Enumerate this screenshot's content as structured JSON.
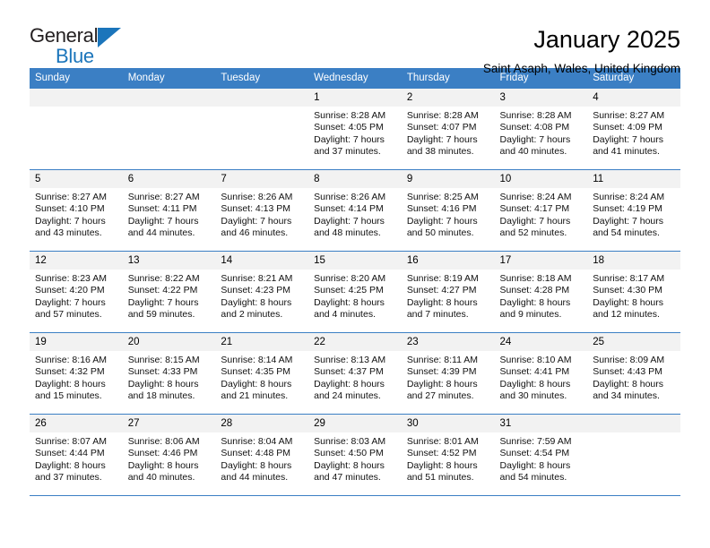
{
  "brand": {
    "name_top": "General",
    "name_bottom": "Blue",
    "accent_color": "#1b75bb"
  },
  "header": {
    "title": "January 2025",
    "subtitle": "Saint Asaph, Wales, United Kingdom"
  },
  "theme": {
    "header_row_bg": "#3b7fc4",
    "daynum_bg": "#f2f2f2",
    "grid_line": "#3b7fc4"
  },
  "labels": {
    "sunrise_prefix": "Sunrise:",
    "sunset_prefix": "Sunset:",
    "daylight_prefix": "Daylight:"
  },
  "weekday_headers": [
    "Sunday",
    "Monday",
    "Tuesday",
    "Wednesday",
    "Thursday",
    "Friday",
    "Saturday"
  ],
  "weeks": [
    [
      {
        "day": ""
      },
      {
        "day": ""
      },
      {
        "day": ""
      },
      {
        "day": "1",
        "sunrise": "Sunrise: 8:28 AM",
        "sunset": "Sunset: 4:05 PM",
        "daylight1": "Daylight: 7 hours",
        "daylight2": "and 37 minutes."
      },
      {
        "day": "2",
        "sunrise": "Sunrise: 8:28 AM",
        "sunset": "Sunset: 4:07 PM",
        "daylight1": "Daylight: 7 hours",
        "daylight2": "and 38 minutes."
      },
      {
        "day": "3",
        "sunrise": "Sunrise: 8:28 AM",
        "sunset": "Sunset: 4:08 PM",
        "daylight1": "Daylight: 7 hours",
        "daylight2": "and 40 minutes."
      },
      {
        "day": "4",
        "sunrise": "Sunrise: 8:27 AM",
        "sunset": "Sunset: 4:09 PM",
        "daylight1": "Daylight: 7 hours",
        "daylight2": "and 41 minutes."
      }
    ],
    [
      {
        "day": "5",
        "sunrise": "Sunrise: 8:27 AM",
        "sunset": "Sunset: 4:10 PM",
        "daylight1": "Daylight: 7 hours",
        "daylight2": "and 43 minutes."
      },
      {
        "day": "6",
        "sunrise": "Sunrise: 8:27 AM",
        "sunset": "Sunset: 4:11 PM",
        "daylight1": "Daylight: 7 hours",
        "daylight2": "and 44 minutes."
      },
      {
        "day": "7",
        "sunrise": "Sunrise: 8:26 AM",
        "sunset": "Sunset: 4:13 PM",
        "daylight1": "Daylight: 7 hours",
        "daylight2": "and 46 minutes."
      },
      {
        "day": "8",
        "sunrise": "Sunrise: 8:26 AM",
        "sunset": "Sunset: 4:14 PM",
        "daylight1": "Daylight: 7 hours",
        "daylight2": "and 48 minutes."
      },
      {
        "day": "9",
        "sunrise": "Sunrise: 8:25 AM",
        "sunset": "Sunset: 4:16 PM",
        "daylight1": "Daylight: 7 hours",
        "daylight2": "and 50 minutes."
      },
      {
        "day": "10",
        "sunrise": "Sunrise: 8:24 AM",
        "sunset": "Sunset: 4:17 PM",
        "daylight1": "Daylight: 7 hours",
        "daylight2": "and 52 minutes."
      },
      {
        "day": "11",
        "sunrise": "Sunrise: 8:24 AM",
        "sunset": "Sunset: 4:19 PM",
        "daylight1": "Daylight: 7 hours",
        "daylight2": "and 54 minutes."
      }
    ],
    [
      {
        "day": "12",
        "sunrise": "Sunrise: 8:23 AM",
        "sunset": "Sunset: 4:20 PM",
        "daylight1": "Daylight: 7 hours",
        "daylight2": "and 57 minutes."
      },
      {
        "day": "13",
        "sunrise": "Sunrise: 8:22 AM",
        "sunset": "Sunset: 4:22 PM",
        "daylight1": "Daylight: 7 hours",
        "daylight2": "and 59 minutes."
      },
      {
        "day": "14",
        "sunrise": "Sunrise: 8:21 AM",
        "sunset": "Sunset: 4:23 PM",
        "daylight1": "Daylight: 8 hours",
        "daylight2": "and 2 minutes."
      },
      {
        "day": "15",
        "sunrise": "Sunrise: 8:20 AM",
        "sunset": "Sunset: 4:25 PM",
        "daylight1": "Daylight: 8 hours",
        "daylight2": "and 4 minutes."
      },
      {
        "day": "16",
        "sunrise": "Sunrise: 8:19 AM",
        "sunset": "Sunset: 4:27 PM",
        "daylight1": "Daylight: 8 hours",
        "daylight2": "and 7 minutes."
      },
      {
        "day": "17",
        "sunrise": "Sunrise: 8:18 AM",
        "sunset": "Sunset: 4:28 PM",
        "daylight1": "Daylight: 8 hours",
        "daylight2": "and 9 minutes."
      },
      {
        "day": "18",
        "sunrise": "Sunrise: 8:17 AM",
        "sunset": "Sunset: 4:30 PM",
        "daylight1": "Daylight: 8 hours",
        "daylight2": "and 12 minutes."
      }
    ],
    [
      {
        "day": "19",
        "sunrise": "Sunrise: 8:16 AM",
        "sunset": "Sunset: 4:32 PM",
        "daylight1": "Daylight: 8 hours",
        "daylight2": "and 15 minutes."
      },
      {
        "day": "20",
        "sunrise": "Sunrise: 8:15 AM",
        "sunset": "Sunset: 4:33 PM",
        "daylight1": "Daylight: 8 hours",
        "daylight2": "and 18 minutes."
      },
      {
        "day": "21",
        "sunrise": "Sunrise: 8:14 AM",
        "sunset": "Sunset: 4:35 PM",
        "daylight1": "Daylight: 8 hours",
        "daylight2": "and 21 minutes."
      },
      {
        "day": "22",
        "sunrise": "Sunrise: 8:13 AM",
        "sunset": "Sunset: 4:37 PM",
        "daylight1": "Daylight: 8 hours",
        "daylight2": "and 24 minutes."
      },
      {
        "day": "23",
        "sunrise": "Sunrise: 8:11 AM",
        "sunset": "Sunset: 4:39 PM",
        "daylight1": "Daylight: 8 hours",
        "daylight2": "and 27 minutes."
      },
      {
        "day": "24",
        "sunrise": "Sunrise: 8:10 AM",
        "sunset": "Sunset: 4:41 PM",
        "daylight1": "Daylight: 8 hours",
        "daylight2": "and 30 minutes."
      },
      {
        "day": "25",
        "sunrise": "Sunrise: 8:09 AM",
        "sunset": "Sunset: 4:43 PM",
        "daylight1": "Daylight: 8 hours",
        "daylight2": "and 34 minutes."
      }
    ],
    [
      {
        "day": "26",
        "sunrise": "Sunrise: 8:07 AM",
        "sunset": "Sunset: 4:44 PM",
        "daylight1": "Daylight: 8 hours",
        "daylight2": "and 37 minutes."
      },
      {
        "day": "27",
        "sunrise": "Sunrise: 8:06 AM",
        "sunset": "Sunset: 4:46 PM",
        "daylight1": "Daylight: 8 hours",
        "daylight2": "and 40 minutes."
      },
      {
        "day": "28",
        "sunrise": "Sunrise: 8:04 AM",
        "sunset": "Sunset: 4:48 PM",
        "daylight1": "Daylight: 8 hours",
        "daylight2": "and 44 minutes."
      },
      {
        "day": "29",
        "sunrise": "Sunrise: 8:03 AM",
        "sunset": "Sunset: 4:50 PM",
        "daylight1": "Daylight: 8 hours",
        "daylight2": "and 47 minutes."
      },
      {
        "day": "30",
        "sunrise": "Sunrise: 8:01 AM",
        "sunset": "Sunset: 4:52 PM",
        "daylight1": "Daylight: 8 hours",
        "daylight2": "and 51 minutes."
      },
      {
        "day": "31",
        "sunrise": "Sunrise: 7:59 AM",
        "sunset": "Sunset: 4:54 PM",
        "daylight1": "Daylight: 8 hours",
        "daylight2": "and 54 minutes."
      },
      {
        "day": ""
      }
    ]
  ]
}
